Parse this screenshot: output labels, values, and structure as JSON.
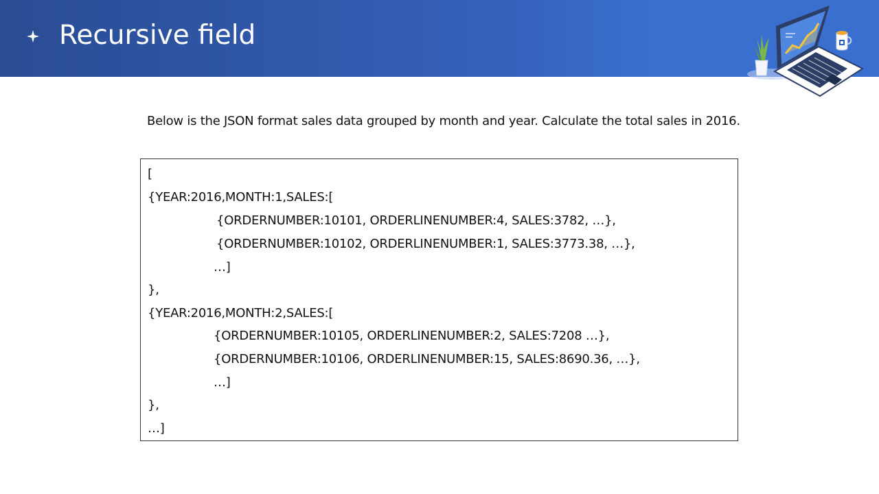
{
  "slide": {
    "title": "Recursive field",
    "prompt": "Below is the JSON format sales data grouped by month and year. Calculate the total sales in 2016.",
    "code_lines": [
      "[",
      "{YEAR:2016,MONTH:1,SALES:[",
      "{ORDERNUMBER:10101, ORDERLINENUMBER:4, SALES:3782, …},",
      "{ORDERNUMBER:10102, ORDERLINENUMBER:1, SALES:3773.38, …},",
      "…]",
      "},",
      "{YEAR:2016,MONTH:2,SALES:[",
      "{ORDERNUMBER:10105, ORDERLINENUMBER:2, SALES:7208 …},",
      "{ORDERNUMBER:10106, ORDERLINENUMBER:15, SALES:8690.36, …},",
      "…]",
      "},",
      "…]"
    ]
  },
  "icons": {
    "bullet": "sparkle-star-icon",
    "illustration": "laptop-chart-illustration"
  },
  "colors": {
    "banner_start": "#2a4c93",
    "banner_end": "#3a6fd0",
    "title_text": "#ffffff",
    "body_text": "#111111"
  }
}
